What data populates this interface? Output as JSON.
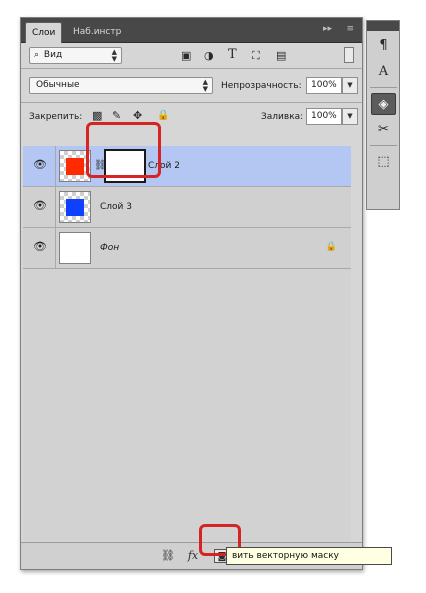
{
  "tabs": {
    "active": "Слои",
    "inactive": "Наб.инстр",
    "collapse_glyph": "▸▸",
    "menu_glyph": "≡"
  },
  "filter": {
    "kind_label": "Вид"
  },
  "blend": {
    "mode": "Обычные",
    "opacity_label": "Непрозрачность:",
    "opacity_value": "100%"
  },
  "lock": {
    "label": "Закрепить:",
    "fill_label": "Заливка:",
    "fill_value": "100%"
  },
  "layers": [
    {
      "name": "Слой 2",
      "color": "#ff2a00",
      "selected": true
    },
    {
      "name": "Слой 3",
      "color": "#1040ff",
      "selected": false
    },
    {
      "name": "Фон",
      "color": "#ffffff",
      "selected": false
    }
  ],
  "tooltip": {
    "text": "вить векторную маску"
  },
  "colors": {
    "highlight": "#d42424",
    "selection": "#b3c7f2"
  }
}
